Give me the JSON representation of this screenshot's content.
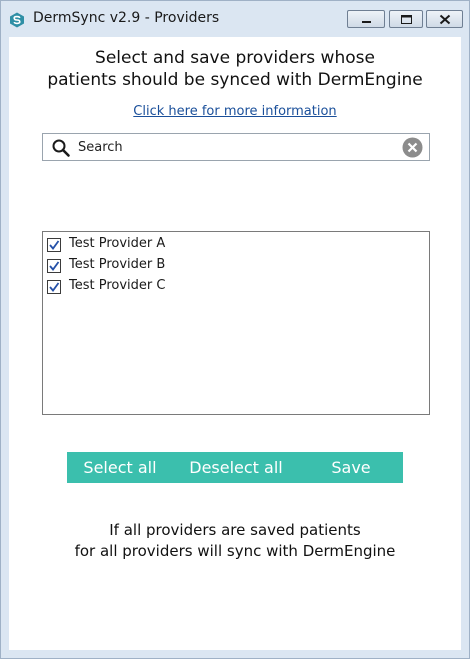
{
  "window": {
    "title": "DermSync v2.9 - Providers",
    "accent_color": "#3bbfad",
    "icon": "dermsync-logo-icon"
  },
  "header": {
    "line1": "Select and save providers whose",
    "line2": "patients should be synced with DermEngine",
    "info_link": "Click here for more information"
  },
  "search": {
    "placeholder": "Search",
    "value": ""
  },
  "providers": [
    {
      "label": "Test Provider A",
      "checked": true
    },
    {
      "label": "Test Provider B",
      "checked": true
    },
    {
      "label": "Test Provider C",
      "checked": true
    }
  ],
  "actions": {
    "select_all": "Select all",
    "deselect_all": "Deselect all",
    "save": "Save"
  },
  "footer": {
    "line1": "If all providers are saved patients",
    "line2": "for all providers will sync with DermEngine"
  }
}
